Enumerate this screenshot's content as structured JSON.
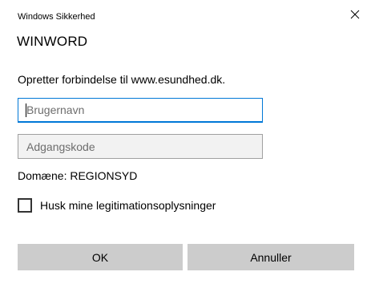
{
  "window": {
    "title": "Windows Sikkerhed",
    "close_glyph": "✕"
  },
  "app_name": "WINWORD",
  "message": "Opretter forbindelse til www.esundhed.dk.",
  "username": {
    "value": "",
    "placeholder": "Brugernavn"
  },
  "password": {
    "value": "",
    "placeholder": "Adgangskode"
  },
  "domain_text": "Domæne: REGIONSYD",
  "remember": {
    "label": "Husk mine legitimationsoplysninger",
    "checked": false
  },
  "buttons": {
    "ok_label": "OK",
    "cancel_label": "Annuller"
  },
  "colors": {
    "accent_focus": "#0078d7",
    "button_bg": "#cccccc",
    "disabled_field_bg": "#f2f2f2"
  }
}
